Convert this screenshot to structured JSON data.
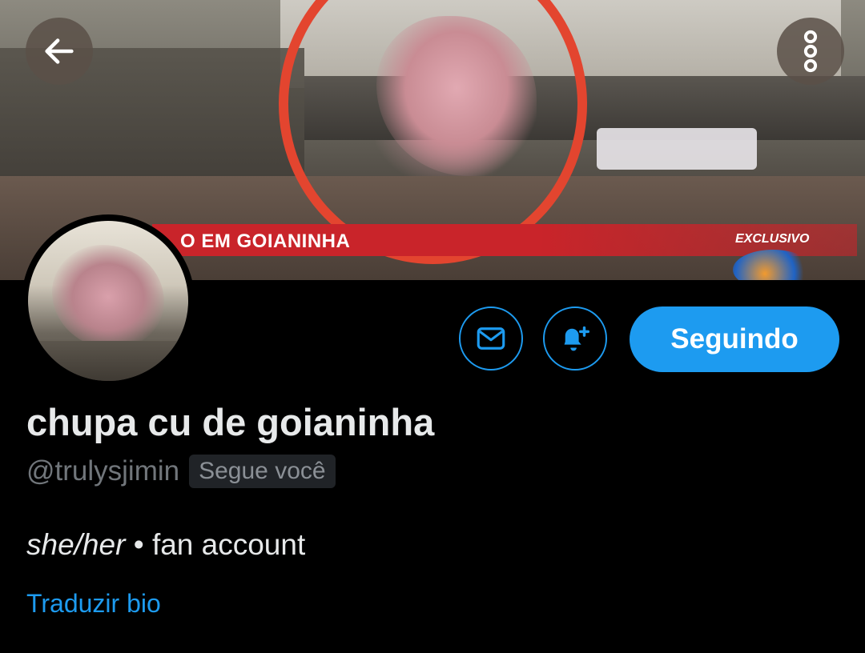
{
  "banner": {
    "caption": "O EM GOIANINHA",
    "exclusive_tag": "EXCLUSIVO"
  },
  "header": {
    "back_icon": "arrow-left-icon",
    "more_icon": "more-vertical-icon"
  },
  "actions": {
    "message_icon": "mail-icon",
    "notify_icon": "bell-plus-icon",
    "follow_label": "Seguindo"
  },
  "profile": {
    "display_name": "chupa cu de goianinha",
    "handle": "@trulysjimin",
    "follows_you": "Segue você",
    "bio_pronouns": "she/her",
    "bio_sep": " • ",
    "bio_text": "fan account",
    "translate_label": "Traduzir bio"
  },
  "colors": {
    "accent": "#1d9bf0",
    "background": "#000000",
    "muted_text": "#71767b"
  }
}
